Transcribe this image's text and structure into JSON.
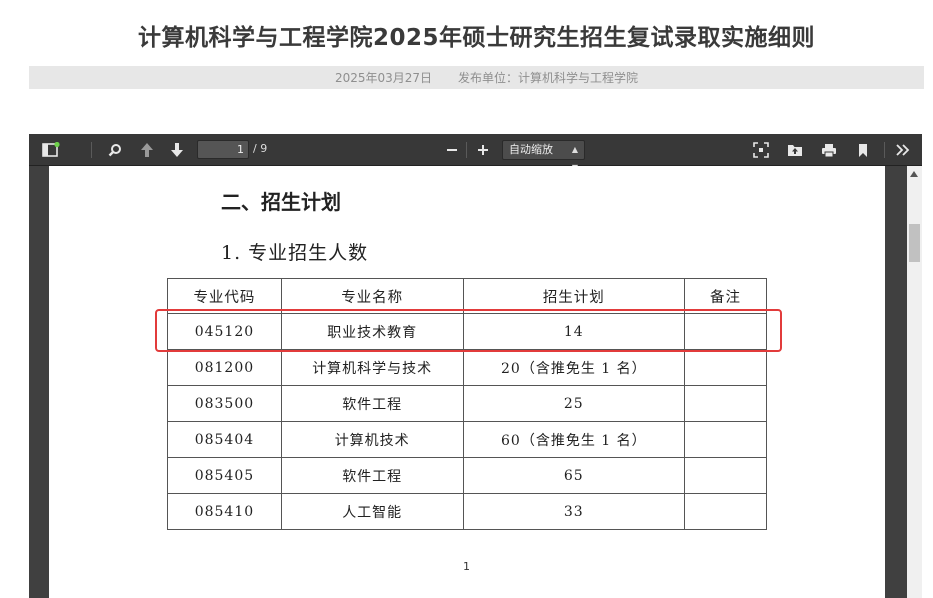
{
  "article": {
    "title": "计算机科学与工程学院2025年硕士研究生招生复试录取实施细则",
    "date": "2025年03月27日",
    "publisher": "发布单位：计算机科学与工程学院"
  },
  "toolbar": {
    "current_page": "1",
    "total_pages": "/ 9",
    "zoom": "自动缩放",
    "icons": [
      "sidebar-toggle-icon",
      "search-icon",
      "arrow-up-icon",
      "arrow-down-icon",
      "minus-icon",
      "plus-icon",
      "fullscreen-icon",
      "open-file-icon",
      "print-icon",
      "bookmark-icon",
      "double-chevron-right-icon"
    ],
    "colors": {
      "toolbar_bg": "#383838",
      "viewer_bg": "#404040",
      "notification_dot": "#6fd14b",
      "highlight": "#e23b3b"
    }
  },
  "document": {
    "section_heading": "二、招生计划",
    "sub_heading": "1. 专业招生人数",
    "table": {
      "headers": [
        "专业代码",
        "专业名称",
        "招生计划",
        "备注"
      ],
      "rows": [
        [
          "045120",
          "职业技术教育",
          "14",
          ""
        ],
        [
          "081200",
          "计算机科学与技术",
          "20（含推免生 1 名）",
          ""
        ],
        [
          "083500",
          "软件工程",
          "25",
          ""
        ],
        [
          "085404",
          "计算机技术",
          "60（含推免生 1 名）",
          ""
        ],
        [
          "085405",
          "软件工程",
          "65",
          ""
        ],
        [
          "085410",
          "人工智能",
          "33",
          ""
        ]
      ]
    },
    "page_number": "1"
  }
}
